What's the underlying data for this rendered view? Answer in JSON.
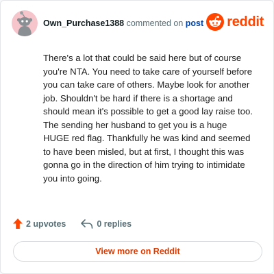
{
  "comment": {
    "username": "Own_Purchase1388",
    "action_text": "commented on",
    "post_link": "post",
    "body": "There's a lot that could be said here but of course you're NTA. You need to take care of yourself before you can take care of others. Maybe look for another job. Shouldn't be hard if there is a shortage and should mean it's possible to get a good lay raise too. The sending her husband to get you is a huge HUGE red flag. Thankfully he was kind and seemed to have been misled, but at first, I thought this was gonna go in the direction of him trying to intimidate you into going."
  },
  "brand": {
    "wordmark": "reddit",
    "color": "#ff4500",
    "icon": "reddit-logo-icon"
  },
  "stats": {
    "upvotes": "2 upvotes",
    "replies": "0 replies",
    "upvote_icon": "upvote-arrow-icon",
    "reply_icon": "reply-arrow-icon",
    "upvote_color": "#ff4500"
  },
  "cta": {
    "label": "View more on Reddit",
    "color": "#d93a00"
  },
  "avatar": {
    "icon": "snoo-avatar-icon",
    "background": "#f6c5cb"
  }
}
